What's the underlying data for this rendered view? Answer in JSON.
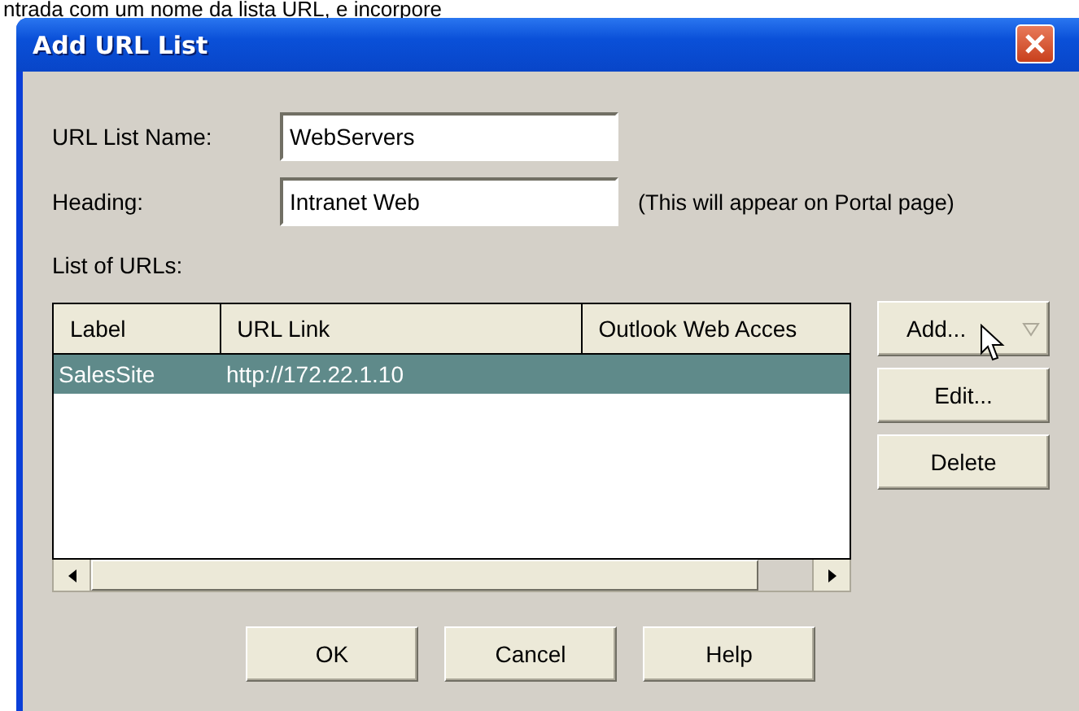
{
  "caption": "ntrada com um nome da lista URL, e incorpore",
  "window": {
    "title": "Add URL List"
  },
  "fields": [
    {
      "label": "URL List Name:",
      "value": "WebServers"
    },
    {
      "label": "Heading:",
      "value": "Intranet Web",
      "note": "(This will appear on Portal page)"
    }
  ],
  "list_label": "List of URLs:",
  "table": {
    "columns": [
      "Label",
      "URL Link",
      "Outlook Web Acces"
    ],
    "rows": [
      {
        "cells": [
          "SalesSite",
          "http://172.22.1.10"
        ],
        "selected": true
      }
    ]
  },
  "side_buttons": [
    {
      "label": "Add...",
      "dropdown": true
    },
    {
      "label": "Edit...",
      "dropdown": false
    },
    {
      "label": "Delete",
      "dropdown": false
    }
  ],
  "buttons": [
    "OK",
    "Cancel",
    "Help"
  ]
}
